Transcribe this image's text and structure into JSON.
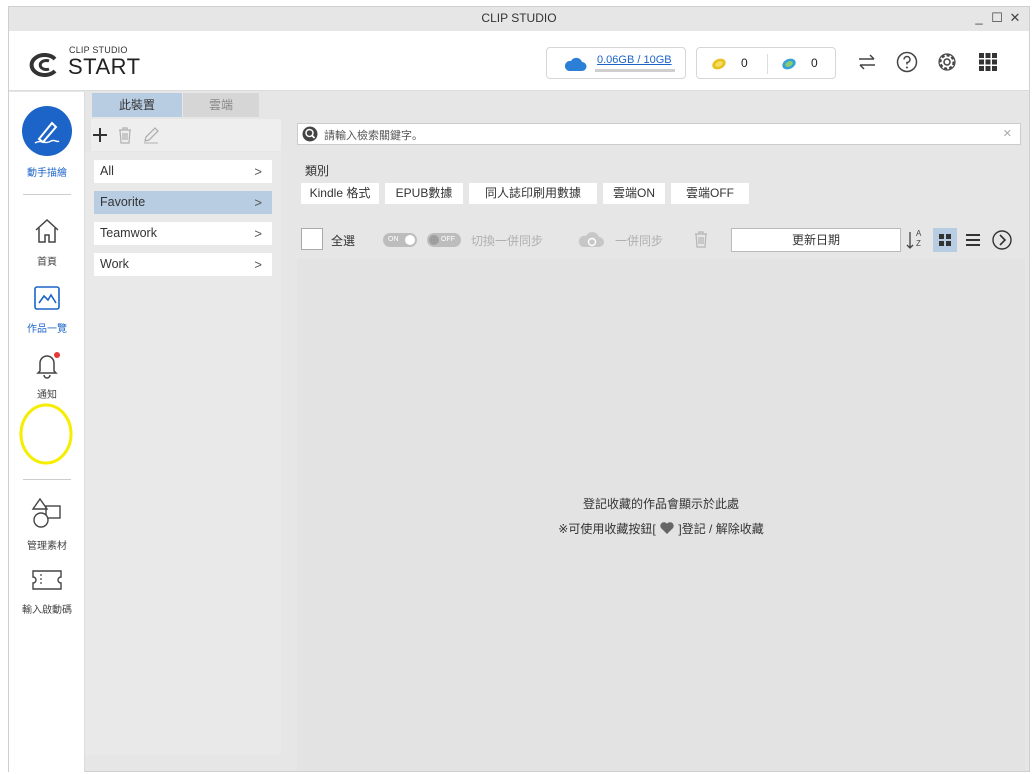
{
  "window": {
    "title": "CLIP STUDIO",
    "controls": {
      "minimize": "_",
      "maximize": "☐",
      "close": "✕"
    }
  },
  "header": {
    "logo_sub": "CLIP STUDIO",
    "logo_main": "START",
    "storage": "0.06GB / 10GB",
    "gold_coins": "0",
    "clippy_points": "0"
  },
  "sidebar": {
    "draw": "動手描繪",
    "home": "首頁",
    "works": "作品一覽",
    "notify": "通知",
    "materials": "管理素材",
    "code": "輸入啟動碼"
  },
  "tabs": {
    "device": "此裝置",
    "cloud": "雲端"
  },
  "search": {
    "placeholder": "請輸入檢索關鍵字。",
    "clear": "✕"
  },
  "lists": [
    {
      "label": "All",
      "chevron": ">"
    },
    {
      "label": "Favorite",
      "chevron": ">"
    },
    {
      "label": "Teamwork",
      "chevron": ">"
    },
    {
      "label": "Work",
      "chevron": ">"
    }
  ],
  "categories": {
    "title": "類別",
    "chips": [
      "Kindle 格式",
      "EPUB數據",
      "同人誌印刷用數據",
      "雲端ON",
      "雲端OFF"
    ]
  },
  "actions": {
    "select_all": "全選",
    "toggle_on": "ON",
    "toggle_off": "OFF",
    "switch_sync": "切換一併同步",
    "sync": "一併同步",
    "sort": "更新日期",
    "sort_az_top": "A",
    "sort_az_bottom": "Z"
  },
  "empty": {
    "line1": "登記收藏的作品會顯示於此處",
    "line2_prefix": "※可使用收藏按鈕[",
    "line2_suffix": "]登記 / 解除收藏"
  },
  "colors": {
    "accent": "#1c64c8",
    "selected": "#b8cde2",
    "badge": "#e53935",
    "highlight_circle": "#f5ee00",
    "coin": "#e8c020"
  },
  "icons": [
    "cloud-icon",
    "coin-icon",
    "clippy-icon",
    "transfer-icon",
    "help-icon",
    "gear-icon",
    "apps-grid-icon",
    "pen-icon",
    "home-icon",
    "gallery-icon",
    "bell-icon",
    "shapes-icon",
    "ticket-icon",
    "plus-icon",
    "trash-icon",
    "edit-icon",
    "search-icon",
    "cloud-sync-icon",
    "sort-az-icon",
    "grid-view-icon",
    "list-view-icon",
    "next-icon",
    "heart-icon"
  ]
}
